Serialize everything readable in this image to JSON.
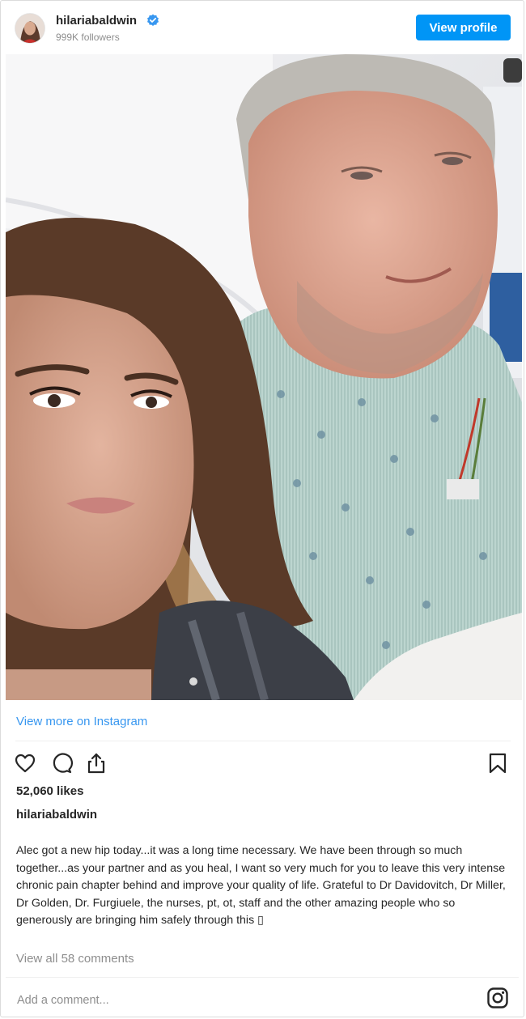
{
  "header": {
    "username": "hilariabaldwin",
    "followers": "999K followers",
    "view_profile_label": "View profile"
  },
  "post": {
    "view_more_label": "View more on Instagram",
    "likes": "52,060 likes",
    "caption_user": "hilariabaldwin",
    "caption": "Alec got a new hip today...it was a long time necessary. We have been through so much together...as your partner and as you heal, I want so very much for you to leave this very intense chronic pain chapter behind and improve your quality of life. Grateful to Dr Davidovitch, Dr Miller, Dr Golden, Dr. Furgiuele, the nurses, pt, ot, staff and the other amazing people who so generously are bringing him safely through this ▯",
    "view_comments_label": "View all 58 comments",
    "comment_placeholder": "Add a comment..."
  },
  "icons": [
    "verified-badge-icon",
    "heart-icon",
    "comment-icon",
    "share-icon",
    "bookmark-icon",
    "instagram-icon"
  ],
  "colors": {
    "accent_blue": "#0095f6",
    "link_blue": "#3897f0",
    "muted_gray": "#8e8e8e",
    "text": "#262626"
  }
}
